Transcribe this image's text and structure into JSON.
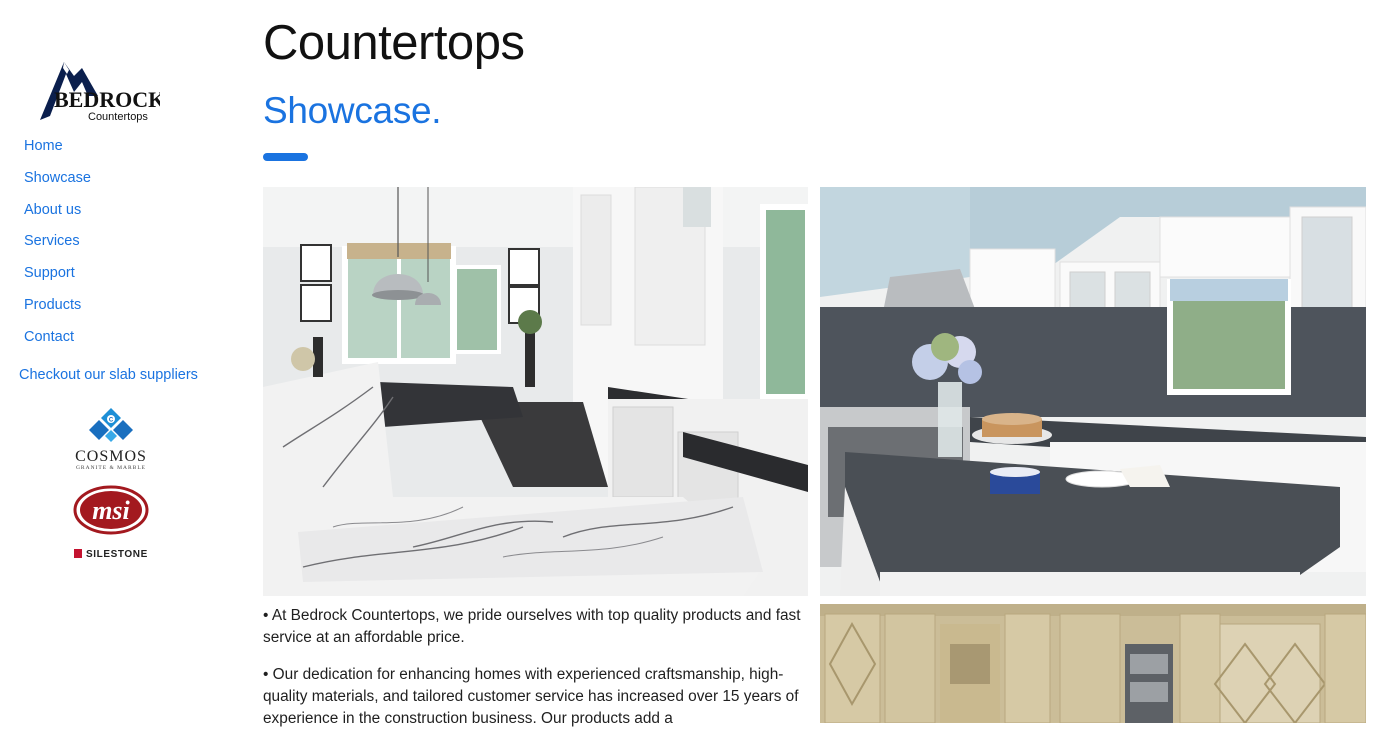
{
  "brand": {
    "logo_text": "BEDROCK",
    "logo_subtext": "Countertops"
  },
  "nav": {
    "items": [
      {
        "label": "Home"
      },
      {
        "label": "Showcase"
      },
      {
        "label": "About us"
      },
      {
        "label": "Services"
      },
      {
        "label": "Support"
      },
      {
        "label": "Products"
      },
      {
        "label": "Contact"
      }
    ],
    "suppliers_link": "Checkout our slab suppliers"
  },
  "suppliers": {
    "cosmos": {
      "name": "COSMOS",
      "tagline": "GRANITE & MARBLE"
    },
    "msi": {
      "name": "msi"
    },
    "silestone": {
      "name": "SILESTONE"
    }
  },
  "main": {
    "title": "Countertops",
    "section_title": "Showcase.",
    "paragraphs": [
      "• At Bedrock Countertops, we pride ourselves with top quality products and fast service at an affordable price.",
      "• Our dedication for enhancing homes with experienced craftsmanship, high-quality materials, and tailored customer service has increased over 15 years of experience in the construction business. Our products add a"
    ]
  },
  "colors": {
    "accent": "#1a73e0",
    "text": "#1f1f1f",
    "silestone_red": "#c4122f",
    "msi_red": "#a3191f"
  },
  "icons": [
    "cosmos-logo-icon",
    "msi-logo-icon",
    "silestone-logo-icon",
    "bedrock-mountain-icon"
  ]
}
